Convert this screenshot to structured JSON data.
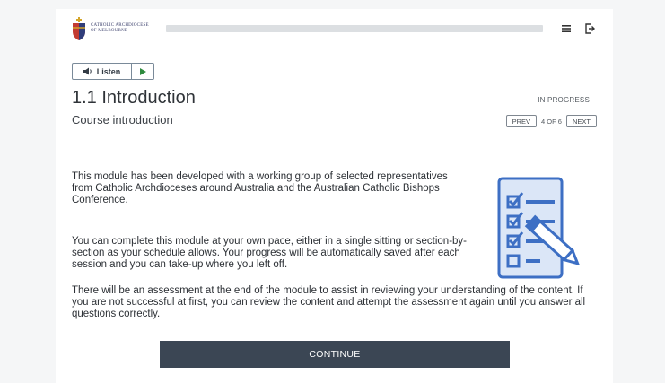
{
  "header": {
    "org_line1": "CATHOLIC ARCHDIOCESE",
    "org_line2": "OF MELBOURNE",
    "icons": [
      "menu-list-icon",
      "exit-icon"
    ]
  },
  "audio": {
    "listen_label": "Listen",
    "icons": [
      "speaker-icon",
      "play-icon"
    ]
  },
  "lesson": {
    "title": "1.1 Introduction",
    "subtitle": "Course introduction",
    "status": "IN PROGRESS",
    "prev_label": "PREV",
    "page_count": "4 OF 6",
    "next_label": "NEXT"
  },
  "content": {
    "paragraph1": "This module has been developed with a working group of selected representatives from Catholic Archdioceses around Australia and the Australian Catholic Bishops Conference.",
    "paragraph2": "You can complete this module at your own pace, either in a single sitting or section-by-section as your schedule allows. Your progress will be automatically saved after each session and you can take-up where you left off.",
    "paragraph3": "There will be an assessment at the end of the module to assist in reviewing your understanding of the content. If you are not successful at first, you can review the content and attempt the assessment again until you answer all questions correctly.",
    "illustration": "checklist-pencil-icon"
  },
  "footer": {
    "continue_label": "CONTINUE"
  },
  "colors": {
    "accent_blue": "#3d6fc4",
    "button_dark": "#3b4654",
    "crest_gold": "#d4a52a",
    "crest_red": "#c23b32"
  }
}
